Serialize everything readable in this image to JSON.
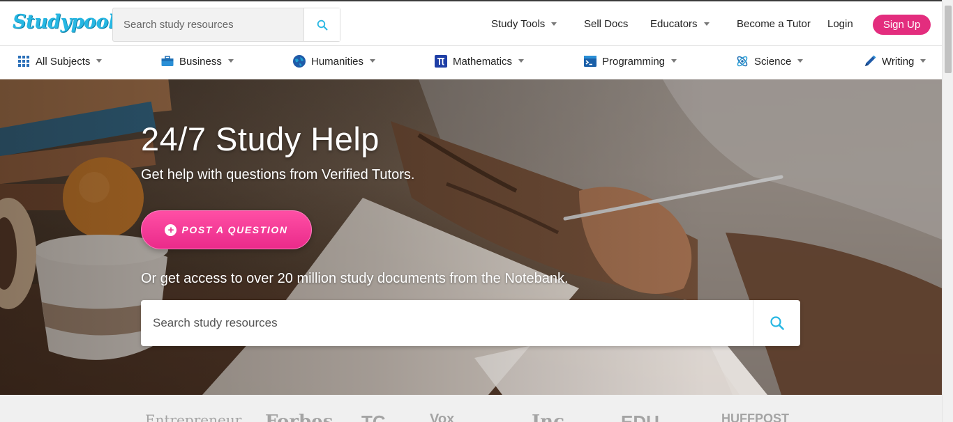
{
  "brand": {
    "logo_text": "Studypool",
    "accent": "#27b7e3",
    "cta_color": "#e32d7e"
  },
  "header": {
    "search_placeholder": "Search study resources",
    "nav": [
      {
        "label": "Study Tools",
        "dropdown": true
      },
      {
        "label": "Sell Docs",
        "dropdown": false
      },
      {
        "label": "Educators",
        "dropdown": true
      },
      {
        "label": "Become a Tutor",
        "dropdown": false
      },
      {
        "label": "Login",
        "dropdown": false
      }
    ],
    "signup_label": "Sign Up"
  },
  "subjects": [
    {
      "label": "All Subjects",
      "icon": "grid-icon"
    },
    {
      "label": "Business",
      "icon": "briefcase-icon"
    },
    {
      "label": "Humanities",
      "icon": "globe-icon"
    },
    {
      "label": "Mathematics",
      "icon": "pi-icon"
    },
    {
      "label": "Programming",
      "icon": "terminal-icon"
    },
    {
      "label": "Science",
      "icon": "atom-icon"
    },
    {
      "label": "Writing",
      "icon": "pen-icon"
    }
  ],
  "hero": {
    "title": "24/7 Study Help",
    "subtitle": "Get help with questions from Verified Tutors.",
    "post_button": "POST A QUESTION",
    "access_text": "Or get access to over 20 million study documents from the Notebank.",
    "search_placeholder": "Search study resources"
  },
  "press_logos": [
    "Entrepreneur",
    "Forbes",
    "TC",
    "Vox",
    "Inc.",
    "EDU",
    "HUFFPOST"
  ]
}
